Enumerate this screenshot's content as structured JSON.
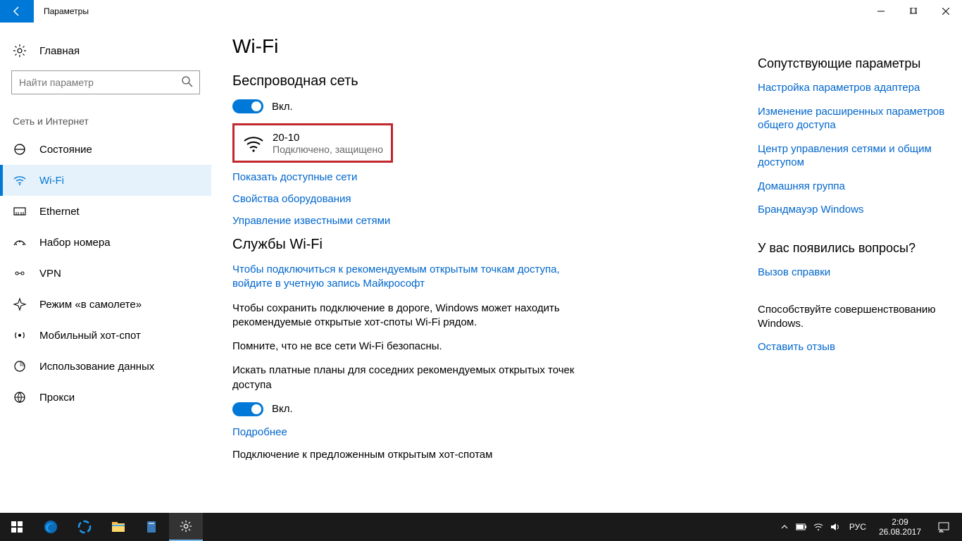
{
  "titlebar": {
    "title": "Параметры"
  },
  "sidebar": {
    "home": "Главная",
    "search_placeholder": "Найти параметр",
    "category": "Сеть и Интернет",
    "items": [
      {
        "label": "Состояние"
      },
      {
        "label": "Wi-Fi"
      },
      {
        "label": "Ethernet"
      },
      {
        "label": "Набор номера"
      },
      {
        "label": "VPN"
      },
      {
        "label": "Режим «в самолете»"
      },
      {
        "label": "Мобильный хот-спот"
      },
      {
        "label": "Использование данных"
      },
      {
        "label": "Прокси"
      }
    ]
  },
  "main": {
    "title": "Wi-Fi",
    "wireless_heading": "Беспроводная сеть",
    "toggle1_label": "Вкл.",
    "network": {
      "name": "20-10",
      "status": "Подключено, защищено"
    },
    "links": {
      "show_networks": "Показать доступные сети",
      "hw_props": "Свойства оборудования",
      "manage_known": "Управление известными сетями"
    },
    "services_heading": "Службы Wi-Fi",
    "services_link": "Чтобы подключиться к рекомендуемым открытым точкам доступа, войдите в учетную запись Майкрософт",
    "services_text1": "Чтобы сохранить подключение в дороге, Windows может находить рекомендуемые открытые хот-споты Wi-Fi рядом.",
    "services_text2": "Помните, что не все сети Wi-Fi безопасны.",
    "services_text3": "Искать платные планы для соседних рекомендуемых открытых точек доступа",
    "toggle2_label": "Вкл.",
    "more_link": "Подробнее",
    "services_text4": "Подключение к предложенным открытым хот-спотам"
  },
  "right": {
    "related_heading": "Сопутствующие параметры",
    "links": [
      "Настройка параметров адаптера",
      "Изменение расширенных параметров общего доступа",
      "Центр управления сетями и общим доступом",
      "Домашняя группа",
      "Брандмауэр Windows"
    ],
    "questions_heading": "У вас появились вопросы?",
    "help_link": "Вызов справки",
    "feedback_heading": "Способствуйте совершенствованию Windows.",
    "feedback_link": "Оставить отзыв"
  },
  "taskbar": {
    "lang": "РУС",
    "time": "2:09",
    "date": "26.08.2017"
  }
}
